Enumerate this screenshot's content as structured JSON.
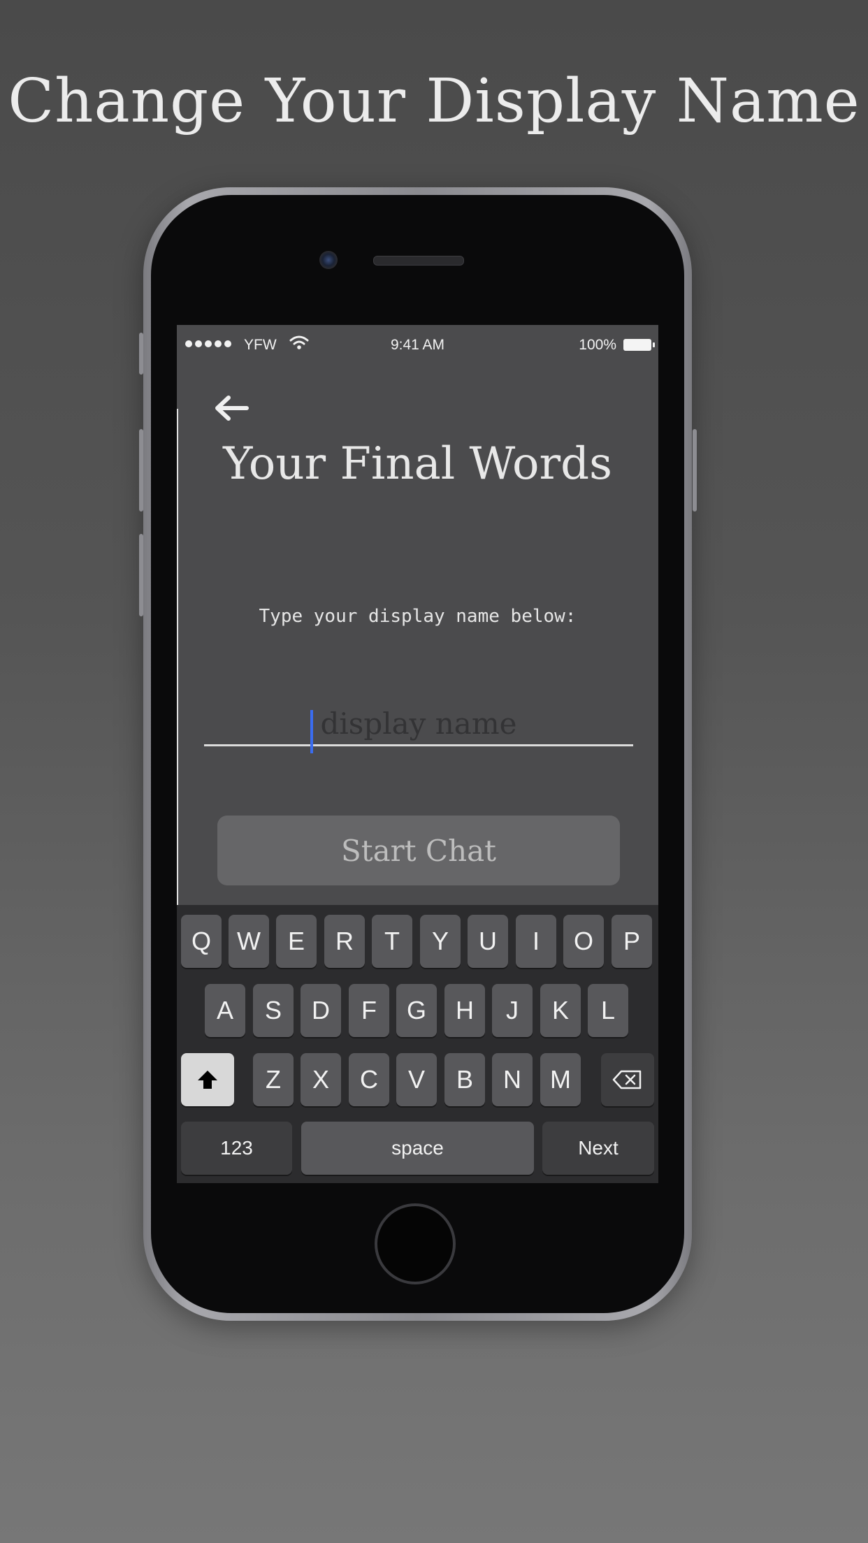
{
  "headline": "Change Your Display Name",
  "status_bar": {
    "carrier": "YFW",
    "time": "9:41 AM",
    "battery": "100%"
  },
  "app": {
    "title": "Your Final Words",
    "prompt": "Type your display name below:",
    "input_placeholder": "display name",
    "input_value": "",
    "start_button": "Start Chat"
  },
  "keyboard": {
    "row1": [
      "Q",
      "W",
      "E",
      "R",
      "T",
      "Y",
      "U",
      "I",
      "O",
      "P"
    ],
    "row2": [
      "A",
      "S",
      "D",
      "F",
      "G",
      "H",
      "J",
      "K",
      "L"
    ],
    "row3": [
      "Z",
      "X",
      "C",
      "V",
      "B",
      "N",
      "M"
    ],
    "numbers_key": "123",
    "space_key": "space",
    "return_key": "Next"
  },
  "colors": {
    "cursor": "#3a6cf0",
    "screen_bg": "#4b4b4d",
    "keyboard_bg": "#2c2c2e"
  }
}
